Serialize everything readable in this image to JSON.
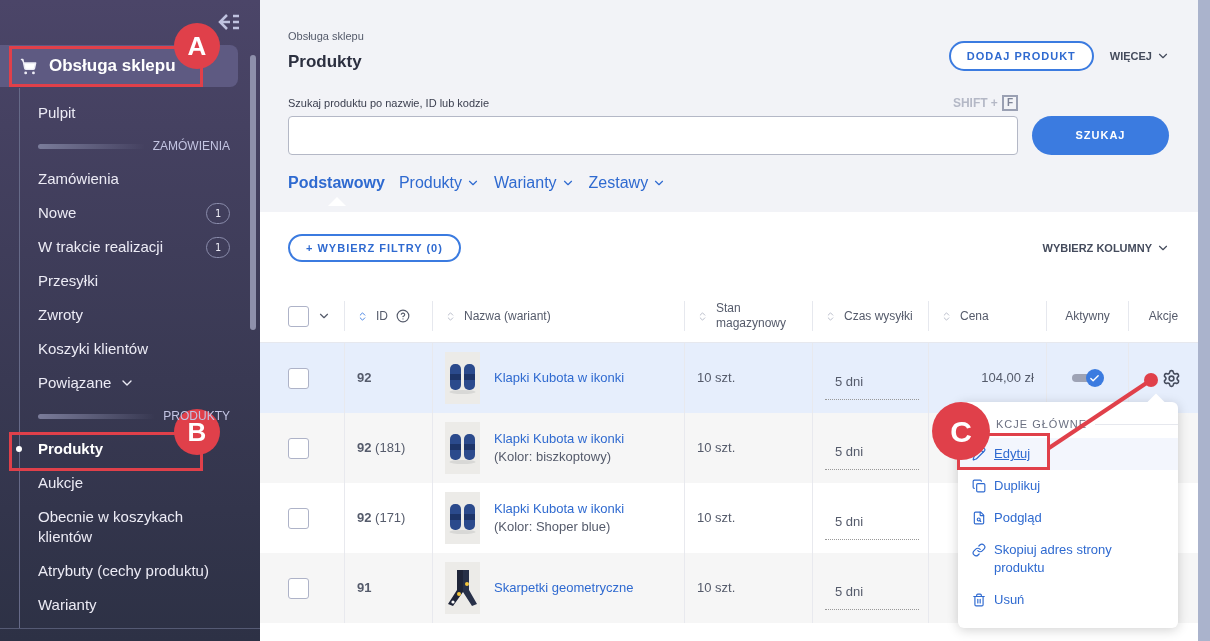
{
  "sidebar": {
    "header": {
      "label": "Obsługa sklepu",
      "selected": true
    },
    "items": [
      {
        "kind": "link",
        "label": "Pulpit",
        "selected": false
      },
      {
        "kind": "section",
        "label": "ZAMÓWIENIA"
      },
      {
        "kind": "link",
        "label": "Zamówienia",
        "selected": false
      },
      {
        "kind": "link",
        "label": "Nowe",
        "selected": false,
        "badge": "1"
      },
      {
        "kind": "link",
        "label": "W trakcie realizacji",
        "selected": false,
        "badge": "1"
      },
      {
        "kind": "link",
        "label": "Przesyłki",
        "selected": false
      },
      {
        "kind": "link",
        "label": "Zwroty",
        "selected": false
      },
      {
        "kind": "link",
        "label": "Koszyki klientów",
        "selected": false
      },
      {
        "kind": "group",
        "label": "Powiązane",
        "expanded": false
      },
      {
        "kind": "section",
        "label": "PRODUKTY"
      },
      {
        "kind": "link",
        "label": "Produkty",
        "selected": true
      },
      {
        "kind": "link",
        "label": "Aukcje",
        "selected": false
      },
      {
        "kind": "link",
        "label": "Obecnie w koszykach klientów",
        "selected": false
      },
      {
        "kind": "link",
        "label": "Atrybuty (cechy produktu)",
        "selected": false
      },
      {
        "kind": "link",
        "label": "Warianty",
        "selected": false
      }
    ]
  },
  "header": {
    "breadcrumb": "Obsługa sklepu",
    "title": "Produkty",
    "add_button": "DODAJ PRODUKT",
    "more_button": "WIĘCEJ"
  },
  "search": {
    "label": "Szukaj produktu po nazwie, ID lub kodzie",
    "shortcut": "SHIFT +",
    "shortcut_key": "F",
    "button": "SZUKAJ"
  },
  "tabs": [
    {
      "label": "Podstawowy",
      "selected": true,
      "dropdown": false
    },
    {
      "label": "Produkty",
      "selected": false,
      "dropdown": true
    },
    {
      "label": "Warianty",
      "selected": false,
      "dropdown": true
    },
    {
      "label": "Zestawy",
      "selected": false,
      "dropdown": true
    }
  ],
  "filters_button": "+ WYBIERZ FILTRY (0)",
  "columns_button": "WYBIERZ KOLUMNY",
  "table": {
    "select_all": {
      "checked": false
    },
    "columns": [
      {
        "label": "ID",
        "sortable": true,
        "help": true
      },
      {
        "label": "Nazwa (wariant)",
        "sortable": true,
        "help": false
      },
      {
        "label": "Stan magazynowy",
        "sortable": true,
        "help": false
      },
      {
        "label": "Czas wysyłki",
        "sortable": true,
        "help": false
      },
      {
        "label": "Cena",
        "sortable": true,
        "help": false
      },
      {
        "label": "Aktywny",
        "sortable": false,
        "help": false
      },
      {
        "label": "Akcje",
        "sortable": false,
        "help": false
      }
    ],
    "rows": [
      {
        "checked": false,
        "highlighted": true,
        "id": "92",
        "name": "Klapki Kubota w ikonki",
        "stock": "10 szt.",
        "shipping": "5 dni",
        "price": "104,00 zł",
        "active": true
      },
      {
        "checked": false,
        "highlighted": false,
        "id": "92",
        "variant_id": "(181)",
        "name": "Klapki Kubota w ikonki",
        "variant": "(Kolor: biszkoptowy)",
        "stock": "10 szt.",
        "shipping": "5 dni"
      },
      {
        "checked": false,
        "highlighted": false,
        "id": "92",
        "variant_id": "(171)",
        "name": "Klapki Kubota w ikonki",
        "variant": "(Kolor: Shoper blue)",
        "stock": "10 szt.",
        "shipping": "5 dni"
      },
      {
        "checked": false,
        "highlighted": false,
        "id": "91",
        "name": "Skarpetki geometryczne",
        "stock": "10 szt.",
        "shipping": "5 dni"
      }
    ]
  },
  "actions_menu": {
    "header": "KCJE GŁÓWNE",
    "items": [
      {
        "label": "Edytuj",
        "selected": true
      },
      {
        "label": "Duplikuj",
        "selected": false
      },
      {
        "label": "Podgląd",
        "selected": false
      },
      {
        "label": "Skopiuj adres strony produktu",
        "selected": false
      },
      {
        "label": "Usuń",
        "selected": false
      }
    ]
  },
  "annotations": [
    {
      "label": "A"
    },
    {
      "label": "B"
    },
    {
      "label": "C"
    }
  ]
}
